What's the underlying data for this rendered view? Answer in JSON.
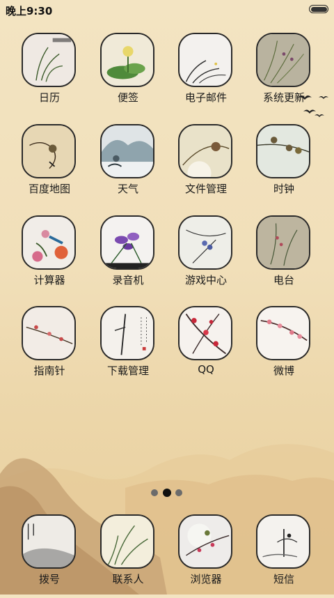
{
  "status_bar": {
    "time": "晚上9:30"
  },
  "apps": [
    {
      "label": "日历"
    },
    {
      "label": "便签"
    },
    {
      "label": "电子邮件"
    },
    {
      "label": "系统更新"
    },
    {
      "label": "百度地图"
    },
    {
      "label": "天气"
    },
    {
      "label": "文件管理"
    },
    {
      "label": "时钟"
    },
    {
      "label": "计算器"
    },
    {
      "label": "录音机"
    },
    {
      "label": "游戏中心"
    },
    {
      "label": "电台"
    },
    {
      "label": "指南针"
    },
    {
      "label": "下载管理"
    },
    {
      "label": "QQ"
    },
    {
      "label": "微博"
    }
  ],
  "dock": [
    {
      "label": "拨号"
    },
    {
      "label": "联系人"
    },
    {
      "label": "浏览器"
    },
    {
      "label": "短信"
    }
  ],
  "page_indicator": {
    "pages": 3,
    "current": 2
  },
  "colors": {
    "background": "#f1dfb9",
    "mountains": "#c9a678",
    "icon_border": "#2a2a2a",
    "text": "#1a1a1a"
  }
}
